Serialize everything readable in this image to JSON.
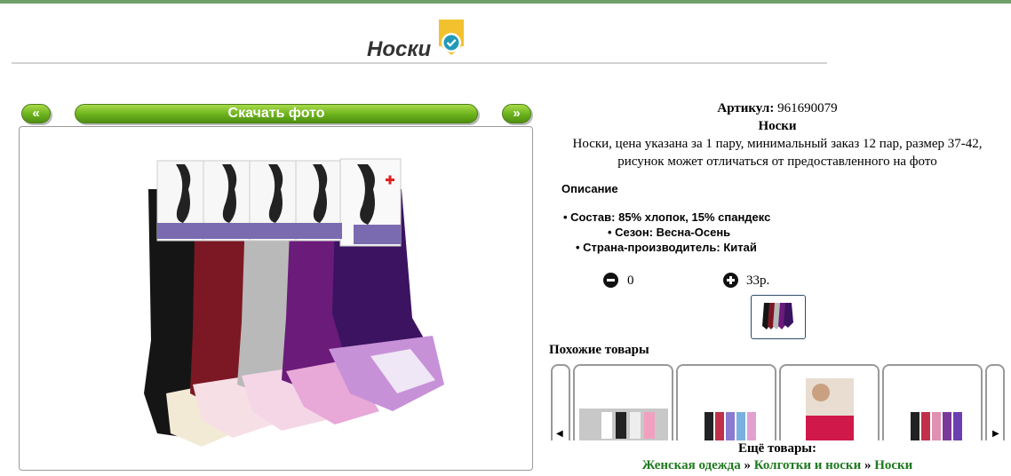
{
  "page": {
    "title": "Носки"
  },
  "colors": {
    "accent_green": "#6bb21c",
    "top_bar": "#6fa06a",
    "link_green": "#1f7a1f"
  },
  "icons": {
    "verified": "verified-check-icon",
    "minus": "minus-circle-icon",
    "plus": "plus-circle-icon"
  },
  "nav": {
    "prev": "«",
    "next": "»",
    "download": "Скачать фото"
  },
  "product": {
    "sku_label": "Артикул:",
    "sku": "961690079",
    "name": "Носки",
    "description": "Носки, цена указана за 1 пару, минимальный заказ 12 пар, размер 37-42, рисунок может отличаться от предоставленного на фото",
    "desc_heading": "Описание",
    "specs": [
      {
        "text": "Состав: 85% хлопок, 15% спандекс"
      },
      {
        "text": "Сезон: Весна-Осень"
      },
      {
        "text": "Страна-производитель: Китай"
      }
    ],
    "quantity": "0",
    "price": "33р."
  },
  "similar": {
    "heading": "Похожие товары",
    "prev_arrow": "◀",
    "next_arrow": "▶"
  },
  "more": {
    "heading": "Ещё товары:",
    "crumbs": [
      "Женская одежда",
      "Колготки и носки",
      "Носки"
    ],
    "separator": "»"
  }
}
